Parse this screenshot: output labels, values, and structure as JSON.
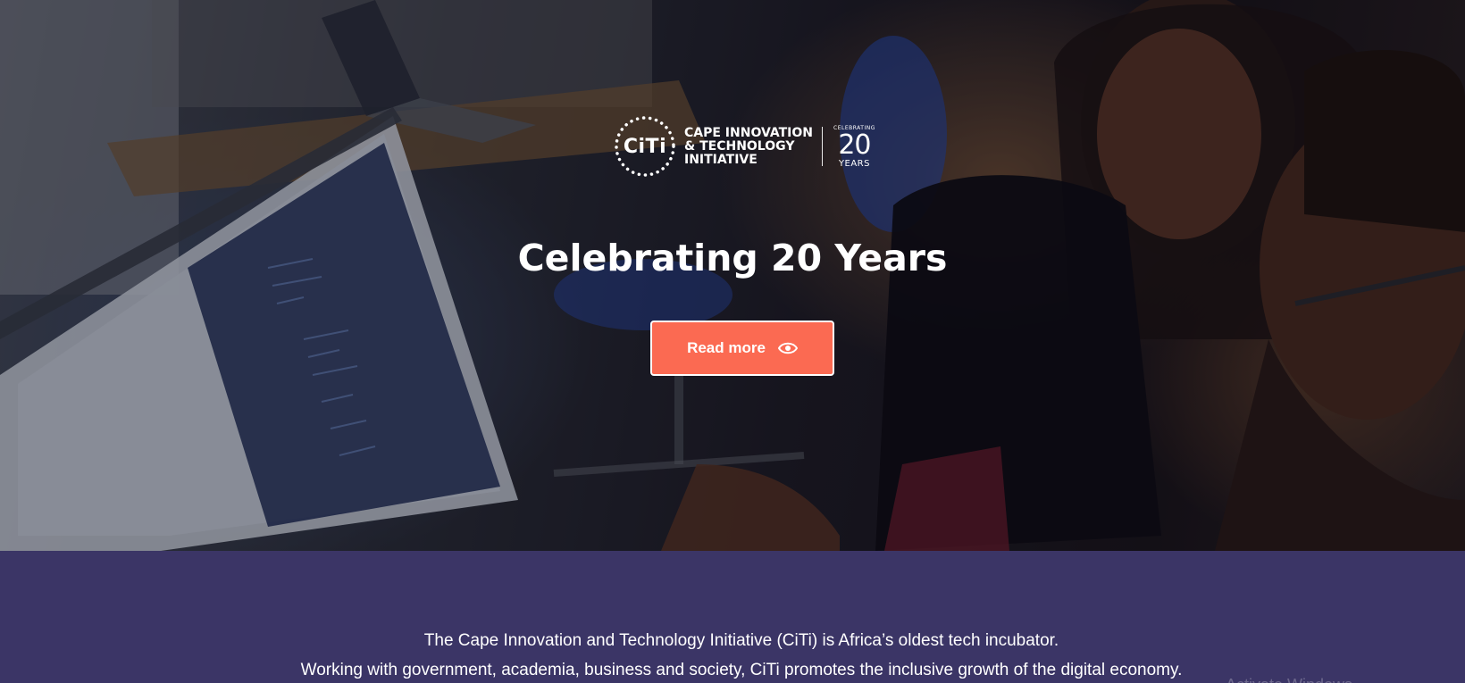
{
  "hero": {
    "logo": {
      "mark_text": "CiTi",
      "name_lines": [
        "CAPE INNOVATION",
        "& TECHNOLOGY",
        "INITIATIVE"
      ],
      "badge_small": "CELEBRATING",
      "badge_number": "20",
      "badge_years": "YEARS"
    },
    "title": "Celebrating 20 Years",
    "read_more_label": "Read more",
    "read_more_icon": "eye-icon",
    "button_color": "#fb6a52"
  },
  "intro": {
    "line1": "The Cape Innovation and Technology Initiative (CiTi) is Africa’s oldest tech incubator.",
    "line2": "Working with government, academia, business and society, CiTi promotes the inclusive growth of the digital economy.",
    "background_color": "#3b3566"
  },
  "watermark": "Activate Windows"
}
